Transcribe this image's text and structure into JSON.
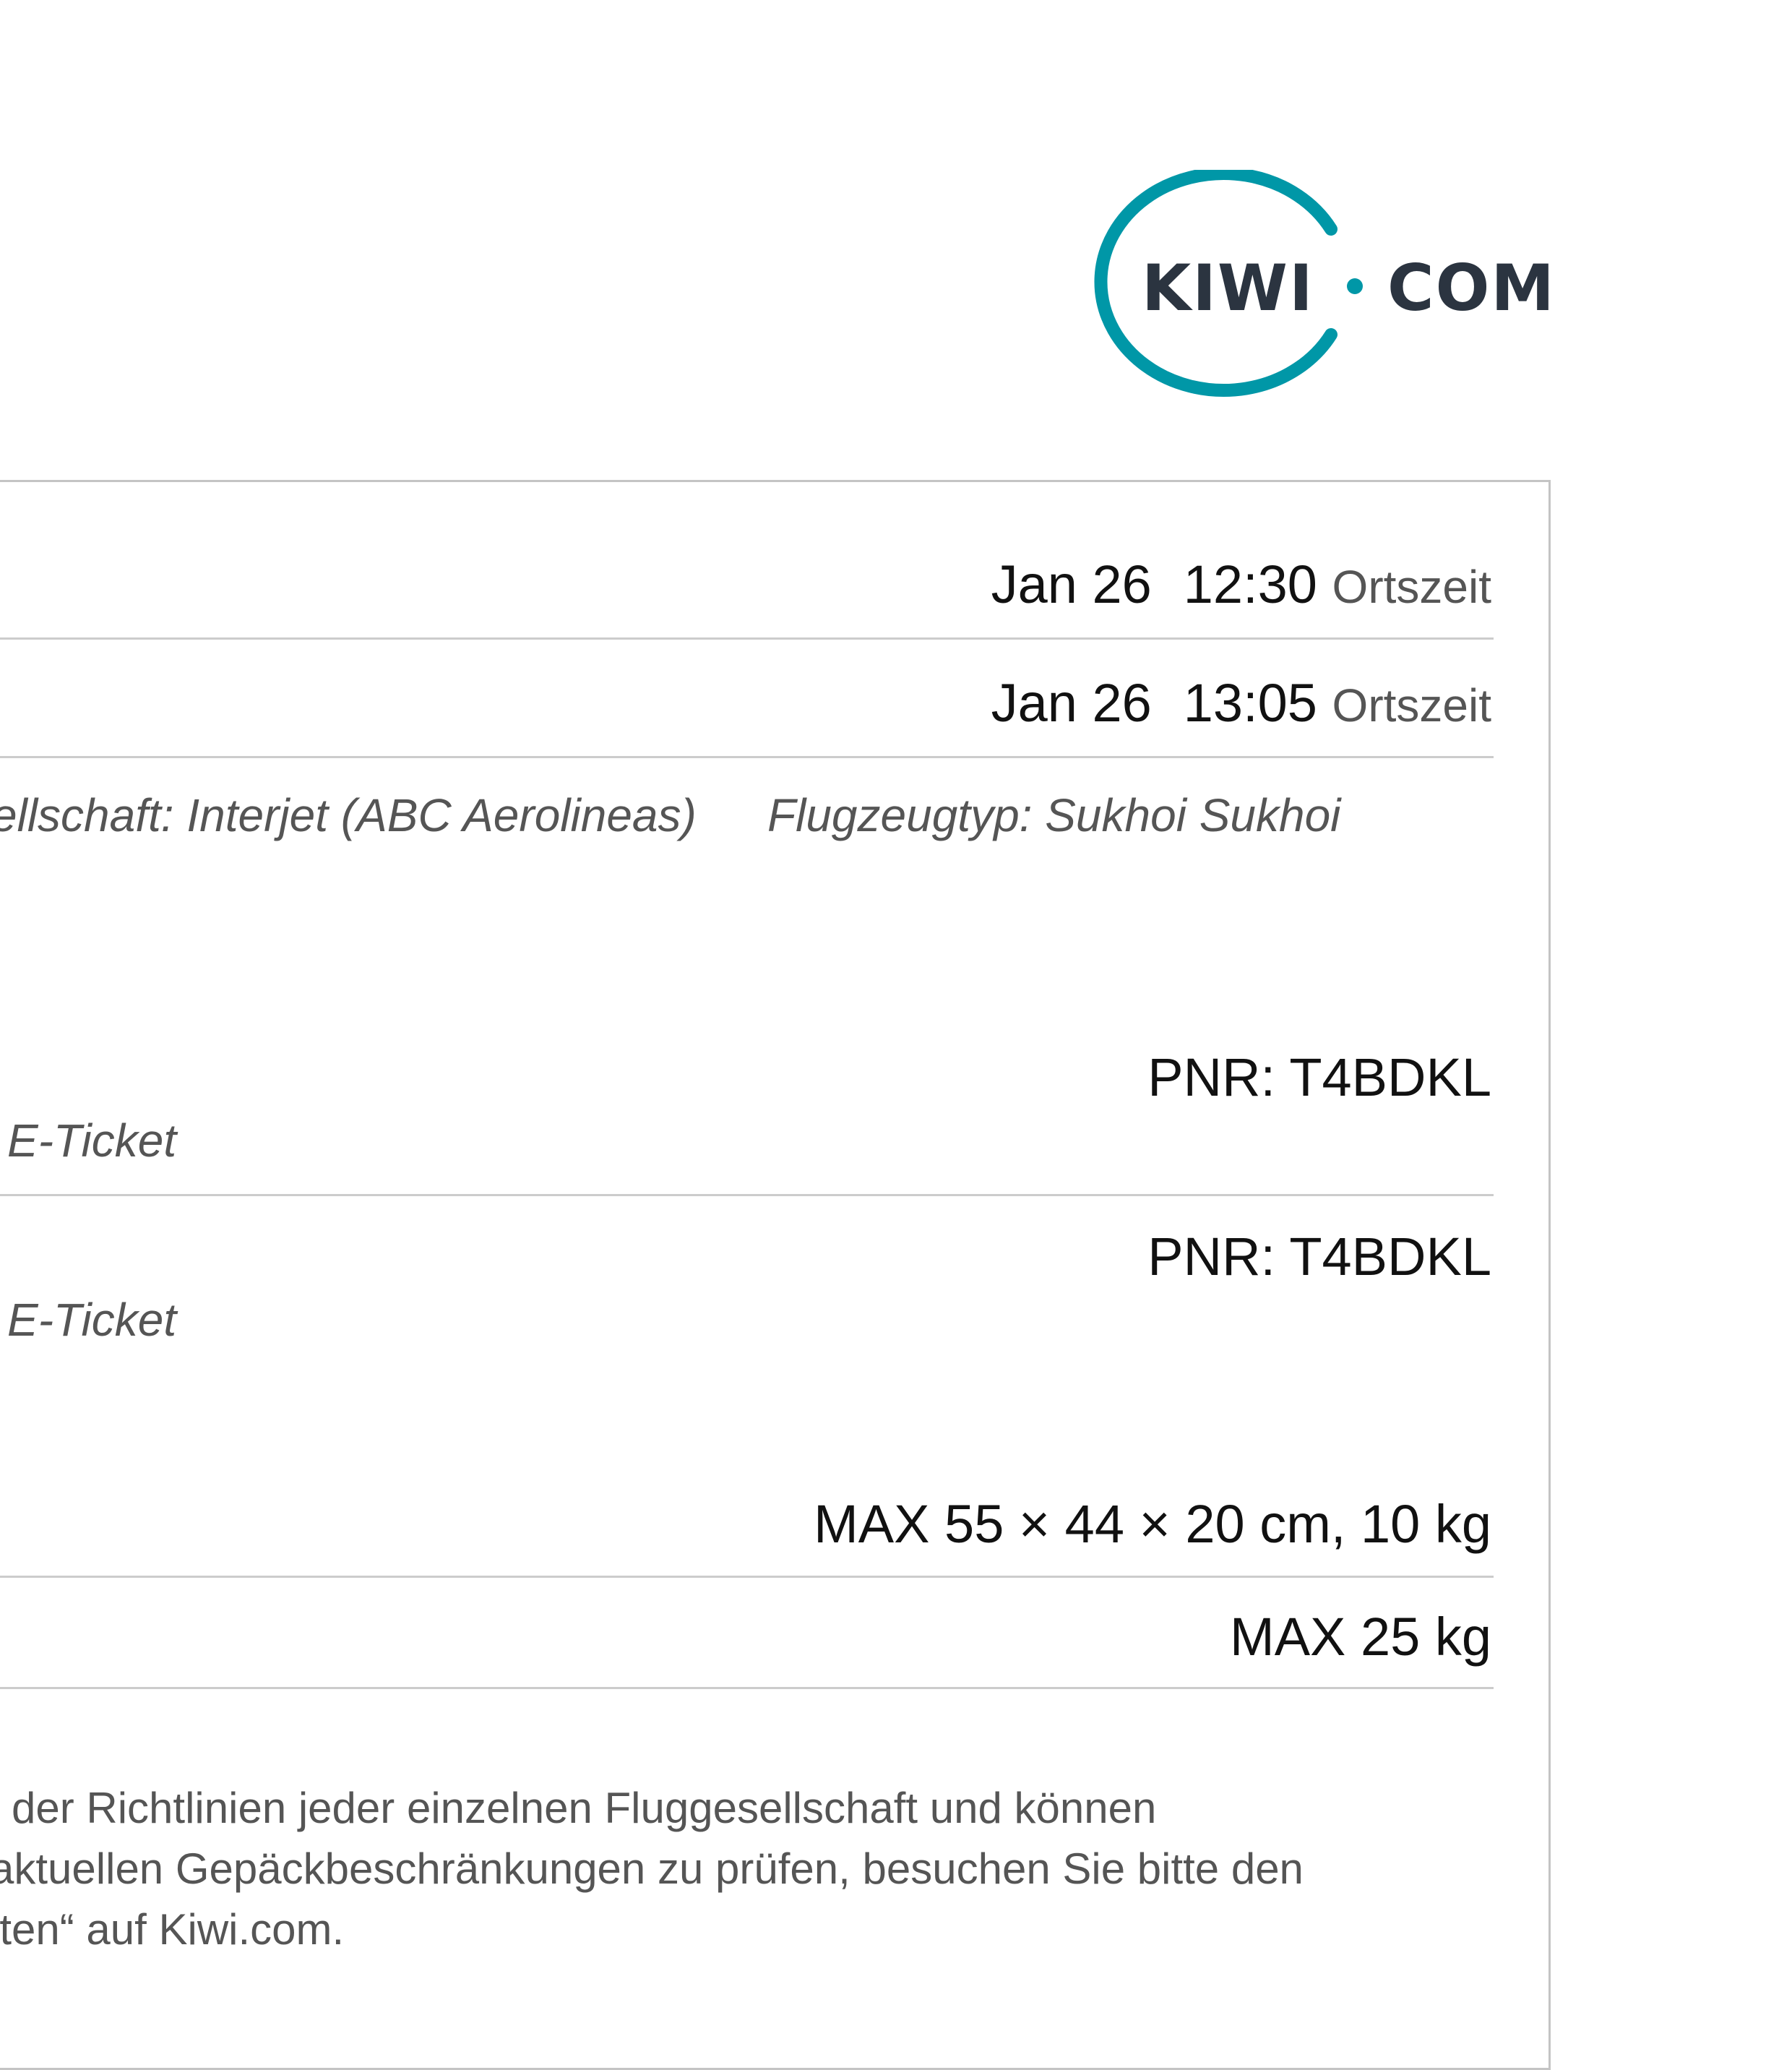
{
  "logo": {
    "left_text": "KIWI",
    "right_text": "COM",
    "brand_color": "#0097a7",
    "text_color": "#2b3440"
  },
  "schedule": {
    "departure": {
      "date": "Jan 26",
      "time": "12:30",
      "suffix": "Ortszeit"
    },
    "arrival": {
      "date": "Jan 26",
      "time": "13:05",
      "suffix": "Ortszeit"
    }
  },
  "flight_info": {
    "airline": "ellschaft: Interjet (ABC Aerolineas)",
    "aircraft": "Flugzeugtyp: Sukhoi Sukhoi"
  },
  "tickets": [
    {
      "pnr": "PNR: T4BDKL",
      "type": "E-Ticket"
    },
    {
      "pnr": "PNR: T4BDKL",
      "type": "E-Ticket"
    }
  ],
  "baggage": {
    "cabin": "MAX 55 × 44 × 20 cm, 10 kg",
    "checked": "MAX 25 kg"
  },
  "note": {
    "line1": "l der Richtlinien jeder einzelnen Fluggesellschaft und können",
    "line2": "aktuellen Gepäckbeschränkungen zu prüfen, besuchen Sie bitte den",
    "line3": "lten“ auf Kiwi.com."
  }
}
